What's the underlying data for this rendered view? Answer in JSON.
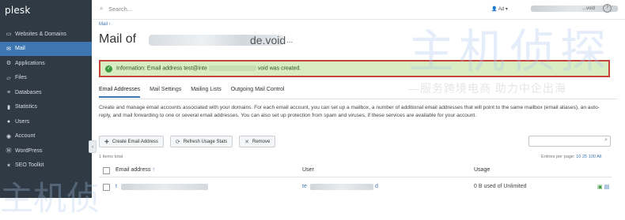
{
  "app": {
    "logo": "plesk"
  },
  "sidebar": {
    "items": [
      {
        "label": "Websites & Domains",
        "icon": "monitor-icon",
        "active": false
      },
      {
        "label": "Mail",
        "icon": "mail-icon",
        "active": true
      },
      {
        "label": "Applications",
        "icon": "gear-icon",
        "active": false
      },
      {
        "label": "Files",
        "icon": "folder-icon",
        "active": false
      },
      {
        "label": "Databases",
        "icon": "database-icon",
        "active": false
      },
      {
        "label": "Statistics",
        "icon": "bar-chart-icon",
        "active": false
      },
      {
        "label": "Users",
        "icon": "user-icon",
        "active": false
      },
      {
        "label": "Account",
        "icon": "account-icon",
        "active": false
      },
      {
        "label": "WordPress",
        "icon": "wordpress-icon",
        "active": false
      },
      {
        "label": "SEO Toolkit",
        "icon": "seo-icon",
        "active": false
      }
    ],
    "collapse_glyph": "‹"
  },
  "header": {
    "search_placeholder": "Search...",
    "user_label": "Ad",
    "domain_label": "...void",
    "help_glyph": "?"
  },
  "page": {
    "breadcrumb": "Mail",
    "title_prefix": "Mail of",
    "title_suffix": "de.void",
    "more_glyph": "..."
  },
  "message": {
    "prefix": "Information:",
    "text_start": "Email address test@inte",
    "text_end": "void was created."
  },
  "tabs": [
    {
      "label": "Email Addresses",
      "active": true
    },
    {
      "label": "Mail Settings",
      "active": false
    },
    {
      "label": "Mailing Lists",
      "active": false
    },
    {
      "label": "Outgoing Mail Control",
      "active": false
    }
  ],
  "description": "Create and manage email accounts associated with your domains. For each email account, you can set up a mailbox, a number of additional email addresses that will point to the same mailbox (email aliases), an auto-reply, and mail forwarding to one or several email addresses. You can also set up protection from spam and viruses, if these services are available for your account.",
  "toolbar": {
    "create_label": "Create Email Address",
    "refresh_label": "Refresh Usage Stats",
    "remove_label": "Remove"
  },
  "list": {
    "total": "1 items total",
    "entries_prefix": "Entries per page:",
    "entries_options": "10 25 100 All",
    "columns": {
      "email": "Email address",
      "user": "User",
      "usage": "Usage"
    },
    "rows": [
      {
        "email": "t",
        "user_start": "te",
        "user_end": "d",
        "usage": "0 B used of Unlimited"
      }
    ]
  },
  "watermark": {
    "large": "主机侦探",
    "small": "—服务跨境电商  助力中企出海",
    "bottom": "主机侦"
  }
}
